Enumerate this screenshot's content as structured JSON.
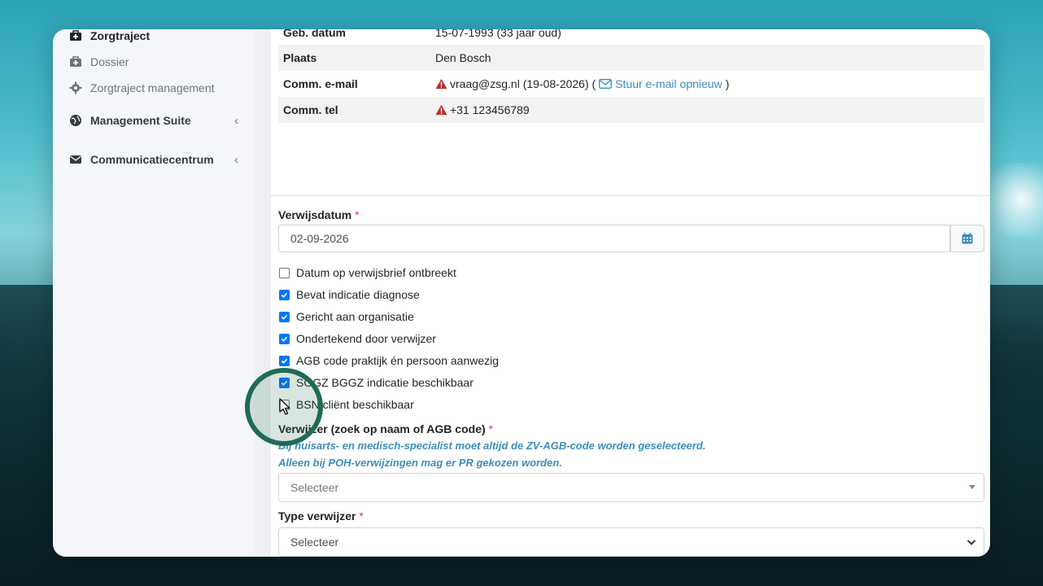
{
  "sidebar": {
    "items": [
      {
        "label": "Zorgtraject",
        "icon": "medkit-icon"
      },
      {
        "label": "Dossier",
        "icon": "medkit-icon"
      },
      {
        "label": "Zorgtraject management",
        "icon": "gear-icon"
      },
      {
        "label": "Management Suite",
        "icon": "globe-icon"
      },
      {
        "label": "Communicatiecentrum",
        "icon": "envelope-icon"
      }
    ]
  },
  "info": {
    "dob_label": "Geb. datum",
    "dob_value": "15-07-1993 (33 jaar oud)",
    "plaats_label": "Plaats",
    "plaats_value": "Den Bosch",
    "email_label": "Comm. e-mail",
    "email_value": "vraag@zsg.nl (19-08-2026) (",
    "email_resend": "Stuur e-mail opnieuw",
    "email_close": ")",
    "tel_label": "Comm. tel",
    "tel_value": "+31 123456789"
  },
  "form": {
    "verwijsdatum_label": "Verwijsdatum",
    "required_mark": "*",
    "verwijsdatum_value": "02-09-2026",
    "checkboxes": [
      {
        "label": "Datum op verwijsbrief ontbreekt",
        "checked": false
      },
      {
        "label": "Bevat indicatie diagnose",
        "checked": true
      },
      {
        "label": "Gericht aan organisatie",
        "checked": true
      },
      {
        "label": "Ondertekend door verwijzer",
        "checked": true
      },
      {
        "label": "AGB code praktijk én persoon aanwezig",
        "checked": true
      },
      {
        "label": "SGGZ BGGZ indicatie beschikbaar",
        "checked": true
      },
      {
        "label": "BSN cliënt beschikbaar",
        "checked": false
      }
    ],
    "verwijzer_label": "Verwijzer (zoek op naam of AGB code)",
    "hint1": "Bij huisarts- en medisch-specialist moet altijd de ZV-AGB-code worden geselecteerd.",
    "hint2": "Alleen bij POH-verwijzingen mag er PR gekozen worden.",
    "verwijzer_placeholder": "Selecteer",
    "type_label": "Type verwijzer",
    "type_value": "Selecteer"
  },
  "colors": {
    "accent": "#3c8dbc",
    "checkbox": "#0075ff",
    "warning": "#d9534f",
    "highlight": "#1f6b56"
  }
}
